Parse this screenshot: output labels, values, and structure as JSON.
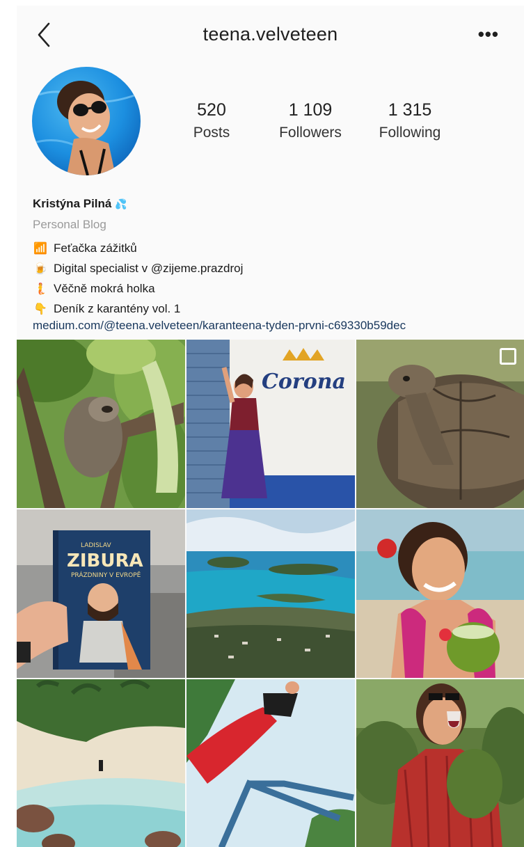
{
  "header": {
    "username": "teena.velveteen",
    "more_label": "•••"
  },
  "stats": {
    "posts": {
      "value": "520",
      "label": "Posts"
    },
    "followers": {
      "value": "1 109",
      "label": "Followers"
    },
    "following": {
      "value": "1 315",
      "label": "Following"
    }
  },
  "bio": {
    "name": "Kristýna Pilná",
    "name_emoji": "💦",
    "category": "Personal Blog",
    "lines": [
      {
        "emoji": "📶",
        "text": "Feťačka zážitků"
      },
      {
        "emoji": "🍺",
        "text": "Digital specialist v @zijeme.prazdroj"
      },
      {
        "emoji": "🧜",
        "text": "Věčně mokrá holka"
      },
      {
        "emoji": "👇",
        "text": "Deník z karantény vol. 1"
      }
    ],
    "link": "medium.com/@teena.velveteen/karanteena-tyden-prvni-c69330b59dec"
  },
  "posts": [
    {
      "subject": "sloth-in-tree"
    },
    {
      "subject": "woman-at-corona-wall",
      "sign_text": "Corona"
    },
    {
      "subject": "giant-tortoise",
      "multi": true
    },
    {
      "subject": "zibura-book",
      "book_author": "LADISLAV",
      "book_title": "ZIBURA",
      "book_subtitle": "PRÁZDNINY V EVROPĚ"
    },
    {
      "subject": "island-aerial-view"
    },
    {
      "subject": "woman-with-coconut"
    },
    {
      "subject": "beach-with-palms"
    },
    {
      "subject": "woman-swinging"
    },
    {
      "subject": "woman-wine-vineyard"
    }
  ]
}
